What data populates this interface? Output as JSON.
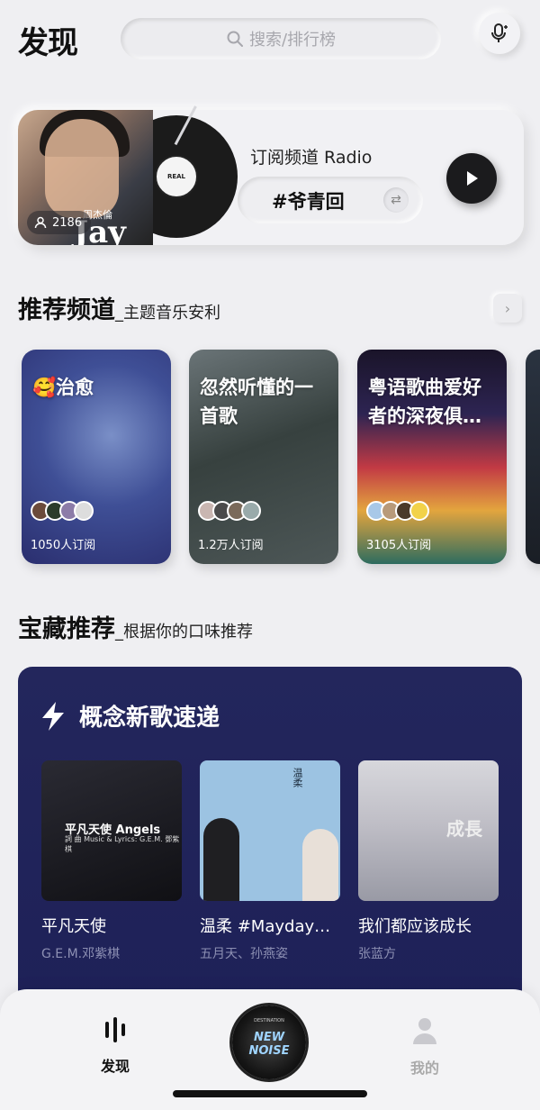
{
  "header": {
    "logo": "发现",
    "search_placeholder": "搜索/排行榜"
  },
  "radio": {
    "cover_text": "Jay",
    "cover_sub": "周杰倫",
    "listeners": "2186",
    "title": "订阅频道 Radio",
    "tag": "#爷青回"
  },
  "channels": {
    "title": "推荐频道",
    "subtitle": "_主题音乐安利",
    "items": [
      {
        "title": "🥰治愈",
        "subs": "1050人订阅"
      },
      {
        "title": "忽然听懂的一首歌",
        "subs": "1.2万人订阅"
      },
      {
        "title": "粤语歌曲爱好者的深夜俱…",
        "subs": "3105人订阅"
      }
    ]
  },
  "treasure": {
    "title": "宝藏推荐",
    "subtitle": "_根据你的口味推荐",
    "card_title": "概念新歌速递",
    "songs": [
      {
        "name": "平凡天使",
        "artist": "G.E.M.邓紫棋",
        "art_text": "平凡天使 Angels",
        "art_sub": "詞 曲 Music & Lyrics: G.E.M. 鄧紫棋"
      },
      {
        "name": "温柔 #Mayday…",
        "artist": "五月天、孙燕姿",
        "art_text": "温柔"
      },
      {
        "name": "我们都应该成长",
        "artist": "张蓝方",
        "art_text": "成長"
      }
    ]
  },
  "tabbar": {
    "discover": "发现",
    "center_album": "NEW NOISE",
    "mine": "我的"
  },
  "colors": {
    "background": "#efeff2",
    "treasure_card": "#23265c",
    "accent_dark": "#1b1b1d"
  }
}
